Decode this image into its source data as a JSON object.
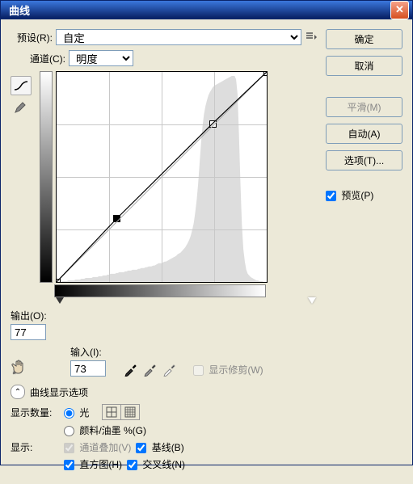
{
  "title": "曲线",
  "preset": {
    "label": "预设(R):",
    "value": "自定"
  },
  "channel": {
    "label": "通道(C):",
    "value": "明度"
  },
  "output": {
    "label": "输出(O):",
    "value": "77"
  },
  "input": {
    "label": "输入(I):",
    "value": "73"
  },
  "show_clipping": "显示修剪(W)",
  "display_options_header": "曲线显示选项",
  "amount": {
    "label": "显示数量:",
    "light": "光",
    "pigment": "颜料/油墨 %(G)"
  },
  "show": {
    "label": "显示:",
    "channel_overlay": "通道叠加(V)",
    "baseline": "基线(B)",
    "histogram": "直方图(H)",
    "intersection": "交叉线(N)"
  },
  "buttons": {
    "ok": "确定",
    "cancel": "取消",
    "smooth": "平滑(M)",
    "auto": "自动(A)",
    "options": "选项(T)..."
  },
  "preview": "预览(P)",
  "chart_data": {
    "type": "line",
    "title": "Curves",
    "xlabel": "输入",
    "ylabel": "输出",
    "xlim": [
      0,
      255
    ],
    "ylim": [
      0,
      255
    ],
    "series": [
      {
        "name": "baseline",
        "x": [
          0,
          255
        ],
        "y": [
          0,
          255
        ]
      },
      {
        "name": "curve",
        "points": [
          [
            0,
            0
          ],
          [
            73,
            77
          ],
          [
            189,
            192
          ],
          [
            255,
            255
          ]
        ]
      }
    ],
    "histogram": [
      0,
      0,
      0,
      0,
      1,
      1,
      1,
      1,
      2,
      2,
      2,
      2,
      2,
      3,
      3,
      3,
      3,
      4,
      4,
      4,
      5,
      5,
      5,
      5,
      5,
      6,
      6,
      6,
      6,
      7,
      7,
      7,
      8,
      8,
      8,
      9,
      9,
      10,
      10,
      10,
      10,
      11,
      11,
      12,
      12,
      12,
      12,
      13,
      13,
      14,
      14,
      14,
      15,
      15,
      15,
      15,
      16,
      16,
      17,
      17,
      17,
      18,
      18,
      19,
      19,
      19,
      20,
      20,
      21,
      22,
      23,
      23,
      23,
      24,
      25,
      25,
      26,
      27,
      28,
      29,
      30,
      31,
      32,
      34,
      35,
      36,
      38,
      40,
      42,
      45,
      48,
      52,
      57,
      64,
      72,
      85,
      100,
      120,
      145,
      170,
      190,
      205,
      215,
      222,
      228,
      232,
      235,
      238,
      240,
      241,
      242,
      243,
      244,
      245,
      246,
      247,
      248,
      249,
      250,
      251,
      252,
      252,
      252,
      248,
      230,
      180,
      120,
      70,
      40,
      25,
      15,
      10,
      8,
      6,
      5,
      4,
      3,
      2,
      2,
      1,
      1,
      1,
      0,
      0
    ]
  }
}
